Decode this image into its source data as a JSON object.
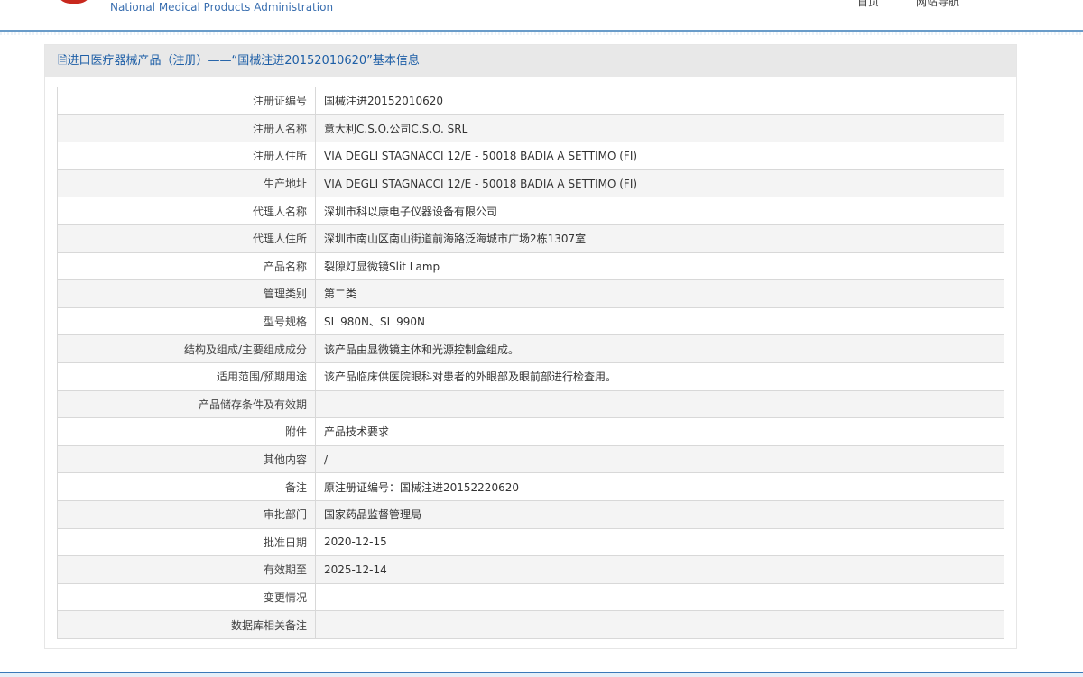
{
  "header": {
    "agency_en": "National Medical Products Administration",
    "nav": [
      "首页",
      "网站导航"
    ]
  },
  "panel": {
    "title": "进口医疗器械产品（注册）——“国械注进20152010620”基本信息"
  },
  "rows": [
    {
      "label": "注册证编号",
      "value": "国械注进20152010620"
    },
    {
      "label": "注册人名称",
      "value": "意大利C.S.O.公司C.S.O. SRL"
    },
    {
      "label": "注册人住所",
      "value": "VIA DEGLI STAGNACCI 12/E - 50018 BADIA A SETTIMO (FI)"
    },
    {
      "label": "生产地址",
      "value": "VIA DEGLI STAGNACCI 12/E - 50018 BADIA A SETTIMO (FI)"
    },
    {
      "label": "代理人名称",
      "value": "深圳市科以康电子仪器设备有限公司"
    },
    {
      "label": "代理人住所",
      "value": "深圳市南山区南山街道前海路泛海城市广场2栋1307室"
    },
    {
      "label": "产品名称",
      "value": "裂隙灯显微镜Slit Lamp"
    },
    {
      "label": "管理类别",
      "value": "第二类"
    },
    {
      "label": "型号规格",
      "value": "SL 980N、SL 990N"
    },
    {
      "label": "结构及组成/主要组成成分",
      "value": "该产品由显微镜主体和光源控制盒组成。"
    },
    {
      "label": "适用范围/预期用途",
      "value": "该产品临床供医院眼科对患者的外眼部及眼前部进行检查用。"
    },
    {
      "label": "产品储存条件及有效期",
      "value": ""
    },
    {
      "label": "附件",
      "value": "产品技术要求"
    },
    {
      "label": "其他内容",
      "value": "/"
    },
    {
      "label": "备注",
      "value": "原注册证编号：国械注进20152220620"
    },
    {
      "label": "审批部门",
      "value": "国家药品监督管理局"
    },
    {
      "label": "批准日期",
      "value": "2020-12-15"
    },
    {
      "label": "有效期至",
      "value": "2025-12-14"
    },
    {
      "label": "变更情况",
      "value": ""
    },
    {
      "label": "数据库相关备注",
      "value": ""
    }
  ]
}
